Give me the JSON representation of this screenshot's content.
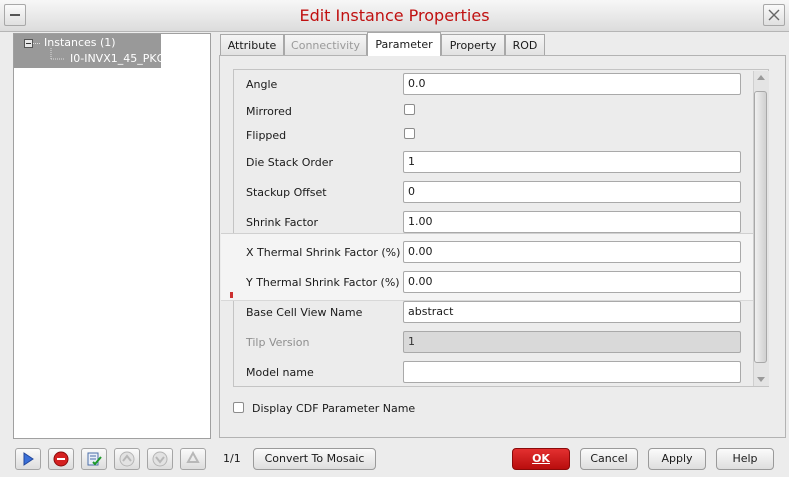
{
  "window": {
    "title": "Edit Instance Properties"
  },
  "tree": {
    "root_label": "Instances (1)",
    "child_label": "I0-INVX1_45_PKG"
  },
  "tabs": [
    {
      "label": "Attribute",
      "state": "normal"
    },
    {
      "label": "Connectivity",
      "state": "disabled"
    },
    {
      "label": "Parameter",
      "state": "active"
    },
    {
      "label": "Property",
      "state": "normal"
    },
    {
      "label": "ROD",
      "state": "normal"
    }
  ],
  "params": {
    "angle": {
      "label": "Angle",
      "value": "0.0"
    },
    "mirrored": {
      "label": "Mirrored",
      "checked": false
    },
    "flipped": {
      "label": "Flipped",
      "checked": false
    },
    "die_stack_order": {
      "label": "Die Stack Order",
      "value": "1"
    },
    "stackup_offset": {
      "label": "Stackup Offset",
      "value": "0"
    },
    "shrink_factor": {
      "label": "Shrink Factor",
      "value": "1.00"
    },
    "x_thermal": {
      "label": "X Thermal Shrink Factor (%)",
      "value": "0.00"
    },
    "y_thermal": {
      "label": "Y Thermal Shrink Factor (%)",
      "value": "0.00"
    },
    "base_cell_view": {
      "label": "Base Cell View Name",
      "value": "abstract"
    },
    "tilp_version": {
      "label": "Tilp Version",
      "value": "1"
    },
    "model_name": {
      "label": "Model name",
      "value": ""
    }
  },
  "display_cdf_label": "Display CDF Parameter Name",
  "footer": {
    "page_indicator": "1/1",
    "convert_label": "Convert To Mosaic",
    "ok_label": "OK",
    "cancel_label": "Cancel",
    "apply_label": "Apply",
    "help_label": "Help"
  },
  "icons": [
    "play-icon",
    "stop-icon",
    "checklist-icon",
    "arrow-up-icon",
    "arrow-down-icon",
    "recycle-icon"
  ],
  "colors": {
    "title_text": "#c01010",
    "ok_button": "#cc1818",
    "tree_selection": "#999999"
  }
}
